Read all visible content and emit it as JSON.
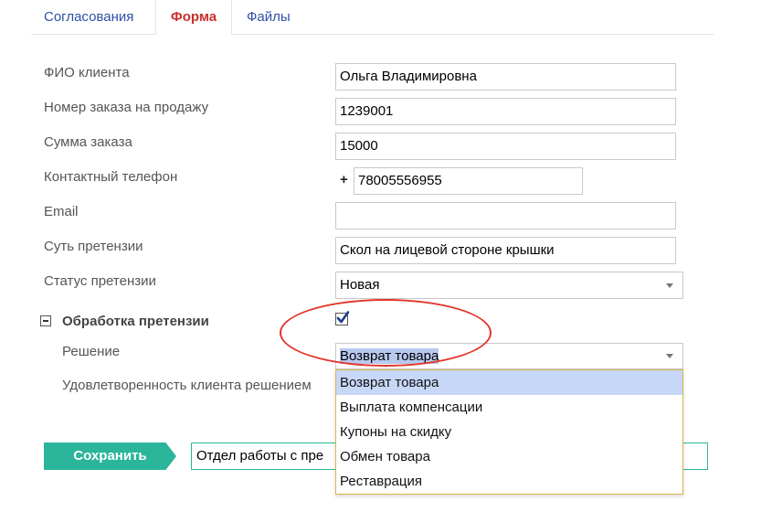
{
  "tabs": [
    {
      "label": "Согласования"
    },
    {
      "label": "Форма"
    },
    {
      "label": "Файлы"
    }
  ],
  "form": {
    "client_name_label": "ФИО клиента",
    "client_name_value": "Ольга Владимировна",
    "order_number_label": "Номер заказа на продажу",
    "order_number_value": "1239001",
    "order_sum_label": "Сумма заказа",
    "order_sum_value": "15000",
    "phone_label": "Контактный телефон",
    "phone_prefix": "+",
    "phone_value": "78005556955",
    "email_label": "Email",
    "email_value": "",
    "claim_essence_label": "Суть претензии",
    "claim_essence_value": "Скол на лицевой стороне крышки",
    "claim_status_label": "Статус претензии",
    "claim_status_value": "Новая",
    "processing_section_label": "Обработка претензии",
    "processing_checked": true,
    "decision_label": "Решение",
    "decision_value": "Возврат товара",
    "satisfaction_label": "Удовлетворенность клиента решением"
  },
  "decision_options": [
    {
      "label": "Возврат товара",
      "selected": true
    },
    {
      "label": "Выплата компенсации",
      "selected": false
    },
    {
      "label": "Купоны на скидку",
      "selected": false
    },
    {
      "label": "Обмен товара",
      "selected": false
    },
    {
      "label": "Реставрация",
      "selected": false
    }
  ],
  "footer": {
    "save_label": "Сохранить",
    "status_text": "Отдел работы с пре"
  },
  "colors": {
    "accent_green": "#2bb59a",
    "active_tab_red": "#c9302c",
    "tab_blue": "#2f4fa5",
    "annotation_red": "#e2352a",
    "selected_option": "#c7d7f7"
  },
  "icons": {
    "checkbox": "check-icon",
    "select_arrow": "chevron-down-icon",
    "collapse": "minus-icon"
  }
}
